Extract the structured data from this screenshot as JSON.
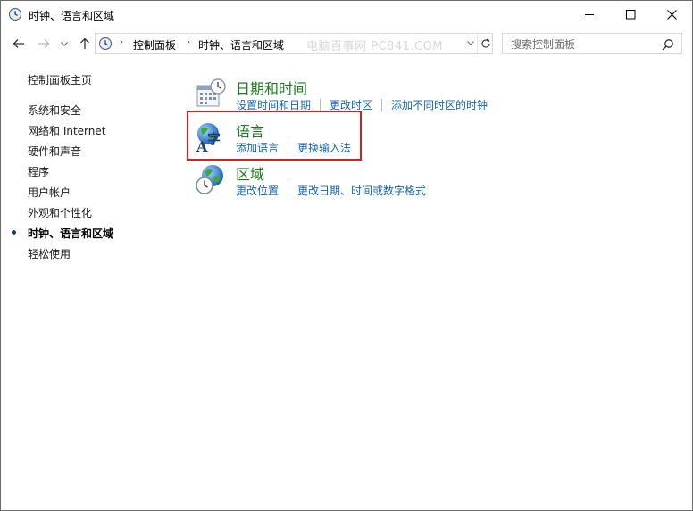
{
  "window": {
    "title": "时钟、语言和区域",
    "buttons": {
      "minimize": "minimize-icon",
      "maximize": "maximize-icon",
      "close": "close-icon"
    }
  },
  "navigation": {
    "breadcrumb": [
      "控制面板",
      "时钟、语言和区域"
    ],
    "watermark": "电脑百事网 PC841.COM",
    "search_placeholder": "搜索控制面板"
  },
  "sidebar": {
    "home": "控制面板主页",
    "items": [
      {
        "label": "系统和安全",
        "current": false
      },
      {
        "label": "网络和 Internet",
        "current": false
      },
      {
        "label": "硬件和声音",
        "current": false
      },
      {
        "label": "程序",
        "current": false
      },
      {
        "label": "用户帐户",
        "current": false
      },
      {
        "label": "外观和个性化",
        "current": false
      },
      {
        "label": "时钟、语言和区域",
        "current": true
      },
      {
        "label": "轻松使用",
        "current": false
      }
    ]
  },
  "categories": [
    {
      "title": "日期和时间",
      "icon": "calendar-clock-icon",
      "links": [
        "设置时间和日期",
        "更改时区",
        "添加不同时区的时钟"
      ]
    },
    {
      "title": "语言",
      "icon": "language-globe-icon",
      "links": [
        "添加语言",
        "更换输入法"
      ],
      "highlighted": true
    },
    {
      "title": "区域",
      "icon": "region-globe-clock-icon",
      "links": [
        "更改位置",
        "更改日期、时间或数字格式"
      ]
    }
  ],
  "colors": {
    "category_title": "#1e7a1e",
    "link": "#1666b0",
    "highlight_border": "#d81e1e"
  }
}
